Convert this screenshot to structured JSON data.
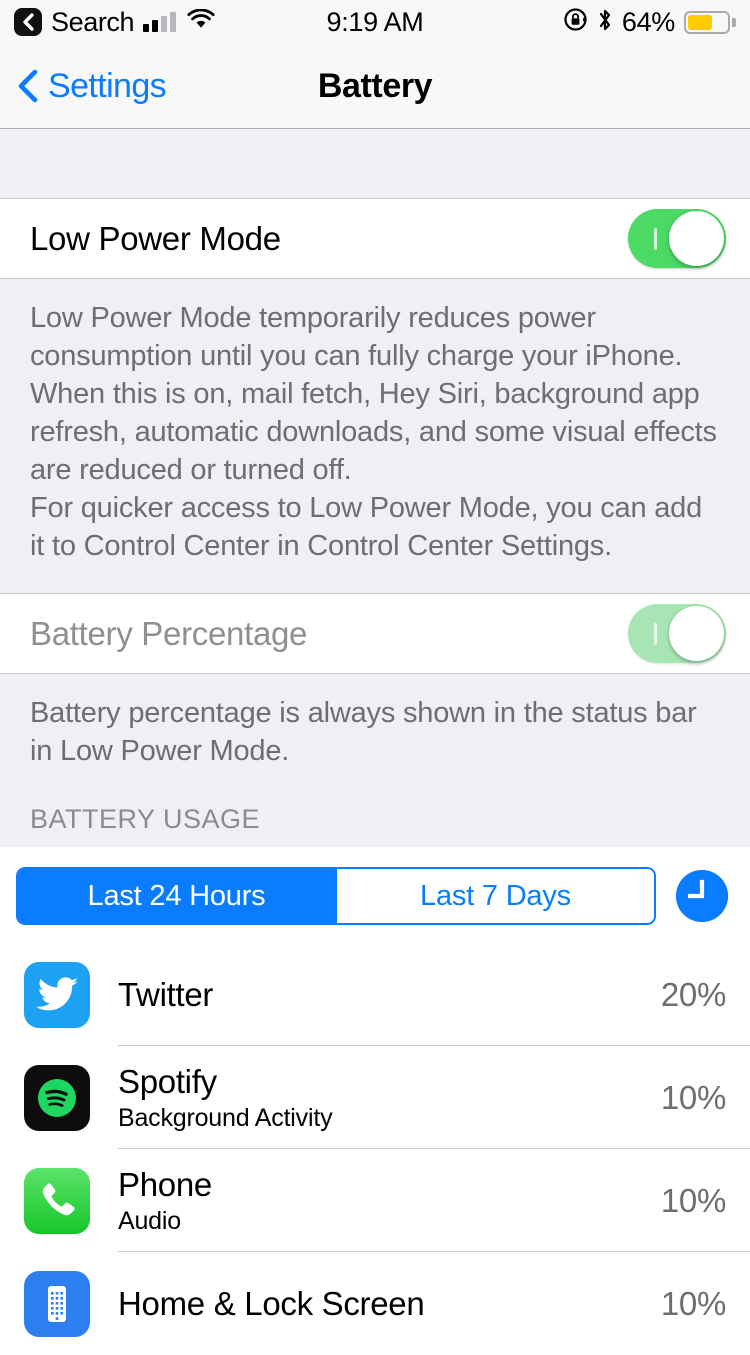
{
  "status_bar": {
    "back_label": "Search",
    "back_icon": "chevron-left-icon",
    "signal_icon": "cellular-signal-icon",
    "signal_bars_filled": 2,
    "signal_bars_total": 4,
    "wifi_icon": "wifi-icon",
    "time": "9:19 AM",
    "rotation_lock_icon": "rotation-lock-icon",
    "bluetooth_icon": "bluetooth-icon",
    "battery_percent": "64%",
    "battery_level": 64,
    "battery_color": "#FFCC00"
  },
  "nav": {
    "back_label": "Settings",
    "back_icon": "chevron-left-icon",
    "title": "Battery"
  },
  "low_power": {
    "label": "Low Power Mode",
    "toggle_on": true,
    "footer_lines": [
      "Low Power Mode temporarily reduces power consumption until you can fully charge your iPhone. When this is on, mail fetch, Hey Siri, background app refresh, automatic downloads, and some visual effects are reduced or turned off.",
      "For quicker access to Low Power Mode, you can add it to Control Center in Control Center Settings."
    ]
  },
  "battery_percentage": {
    "label": "Battery Percentage",
    "toggle_on": true,
    "disabled": true,
    "footer": "Battery percentage is always shown in the status bar in Low Power Mode."
  },
  "battery_usage": {
    "section_header": "BATTERY USAGE",
    "segments": [
      {
        "label": "Last 24 Hours",
        "active": true
      },
      {
        "label": "Last 7 Days",
        "active": false
      }
    ],
    "clock_button_icon": "clock-icon",
    "accent_color": "#0A7CFF",
    "apps": [
      {
        "name": "Twitter",
        "subtitle": "",
        "percent": "20%",
        "icon": "twitter-icon"
      },
      {
        "name": "Spotify",
        "subtitle": "Background Activity",
        "percent": "10%",
        "icon": "spotify-icon"
      },
      {
        "name": "Phone",
        "subtitle": "Audio",
        "percent": "10%",
        "icon": "phone-icon"
      },
      {
        "name": "Home & Lock Screen",
        "subtitle": "",
        "percent": "10%",
        "icon": "home-lock-screen-icon"
      }
    ]
  }
}
